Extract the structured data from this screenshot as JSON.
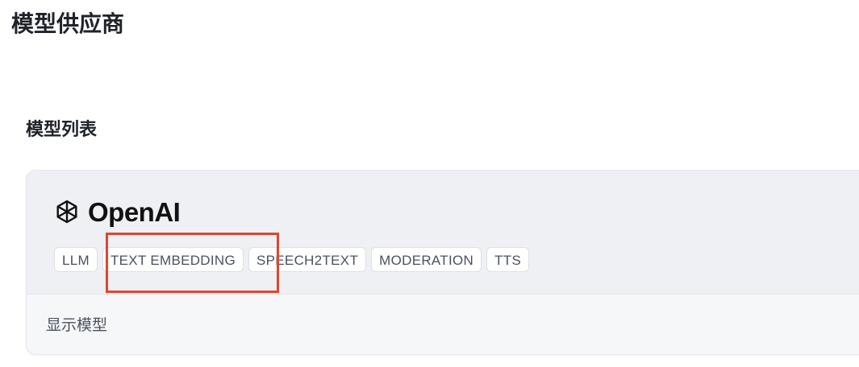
{
  "page": {
    "title": "模型供应商"
  },
  "section": {
    "title": "模型列表"
  },
  "provider": {
    "name": "OpenAI",
    "logo_icon": "openai-logo-icon",
    "tags": [
      "LLM",
      "TEXT EMBEDDING",
      "SPEECH2TEXT",
      "MODERATION",
      "TTS"
    ],
    "show_models_label": "显示模型"
  },
  "annotation": {
    "color": "#e0452f",
    "highlighted_tag": "TEXT EMBEDDING"
  }
}
